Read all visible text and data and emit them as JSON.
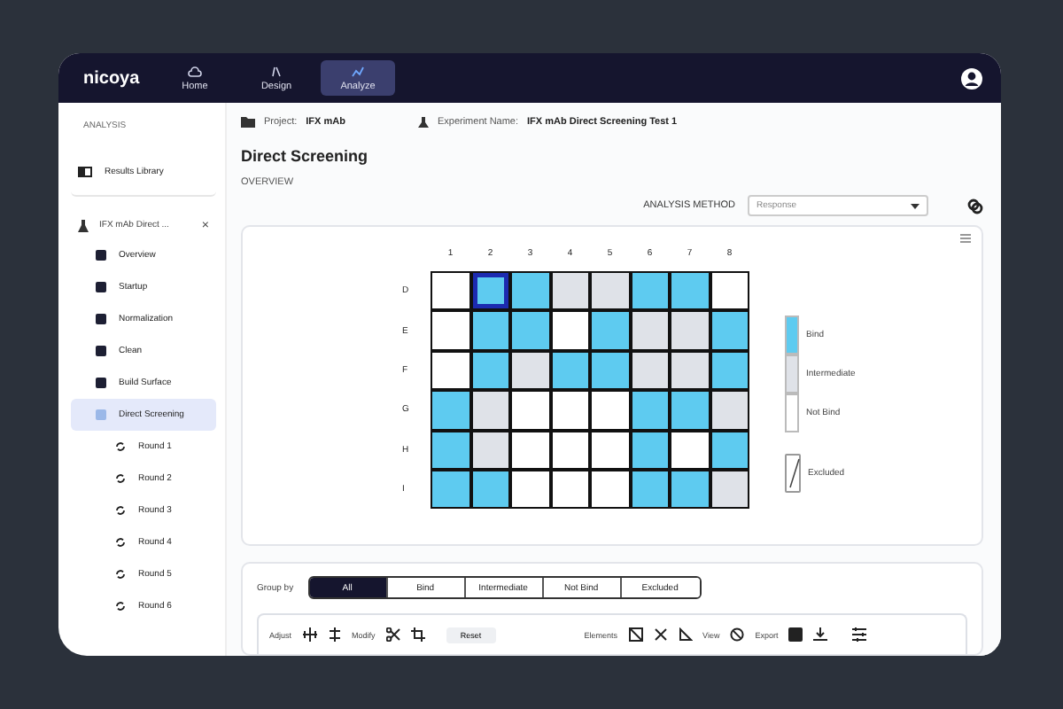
{
  "topbar": {
    "logo": "nicoya",
    "nav": [
      {
        "label": "Home",
        "selected": false
      },
      {
        "label": "Design",
        "selected": false
      },
      {
        "label": "Analyze",
        "selected": true
      }
    ]
  },
  "sidebar": {
    "heading": "ANALYSIS",
    "library": "Results Library",
    "experiment": "IFX mAb Direct ...",
    "close": "×",
    "items": [
      {
        "label": "Overview",
        "kind": "step",
        "selected": false
      },
      {
        "label": "Startup",
        "kind": "step",
        "selected": false
      },
      {
        "label": "Normalization",
        "kind": "step",
        "selected": false
      },
      {
        "label": "Clean",
        "kind": "step",
        "selected": false
      },
      {
        "label": "Build Surface",
        "kind": "step",
        "selected": false
      },
      {
        "label": "Direct Screening",
        "kind": "step",
        "selected": true
      },
      {
        "label": "Round 1",
        "kind": "round",
        "selected": false
      },
      {
        "label": "Round 2",
        "kind": "round",
        "selected": false
      },
      {
        "label": "Round 3",
        "kind": "round",
        "selected": false
      },
      {
        "label": "Round 4",
        "kind": "round",
        "selected": false
      },
      {
        "label": "Round 5",
        "kind": "round",
        "selected": false
      },
      {
        "label": "Round 6",
        "kind": "round",
        "selected": false
      }
    ]
  },
  "header": {
    "project_label": "Project:",
    "project": "IFX mAb",
    "experiment_label": "Experiment Name:",
    "experiment": "IFX mAb Direct Screening Test 1",
    "title": "Direct Screening",
    "section": "OVERVIEW",
    "method_label": "ANALYSIS METHOD",
    "method_value": "Response"
  },
  "plate": {
    "columns": [
      "1",
      "2",
      "3",
      "4",
      "5",
      "6",
      "7",
      "8"
    ],
    "rows": [
      {
        "label": "D",
        "cells": [
          {
            "kind": "not_bind",
            "selected": false
          },
          {
            "kind": "bind",
            "selected": true
          },
          {
            "kind": "bind",
            "selected": false
          },
          {
            "kind": "intermediate",
            "selected": false
          },
          {
            "kind": "intermediate",
            "selected": false
          },
          {
            "kind": "bind",
            "selected": false
          },
          {
            "kind": "bind",
            "selected": false
          },
          {
            "kind": "not_bind",
            "selected": false
          }
        ]
      },
      {
        "label": "E",
        "cells": [
          {
            "kind": "not_bind",
            "selected": false
          },
          {
            "kind": "bind",
            "selected": false
          },
          {
            "kind": "bind",
            "selected": false
          },
          {
            "kind": "not_bind",
            "selected": false
          },
          {
            "kind": "bind",
            "selected": false
          },
          {
            "kind": "intermediate",
            "selected": false
          },
          {
            "kind": "intermediate",
            "selected": false
          },
          {
            "kind": "bind",
            "selected": false
          }
        ]
      },
      {
        "label": "F",
        "cells": [
          {
            "kind": "not_bind",
            "selected": false
          },
          {
            "kind": "bind",
            "selected": false
          },
          {
            "kind": "intermediate",
            "selected": false
          },
          {
            "kind": "bind",
            "selected": false
          },
          {
            "kind": "bind",
            "selected": false
          },
          {
            "kind": "intermediate",
            "selected": false
          },
          {
            "kind": "intermediate",
            "selected": false
          },
          {
            "kind": "bind",
            "selected": false
          }
        ]
      },
      {
        "label": "G",
        "cells": [
          {
            "kind": "bind",
            "selected": false
          },
          {
            "kind": "intermediate",
            "selected": false
          },
          {
            "kind": "not_bind",
            "selected": false
          },
          {
            "kind": "not_bind",
            "selected": false
          },
          {
            "kind": "not_bind",
            "selected": false
          },
          {
            "kind": "bind",
            "selected": false
          },
          {
            "kind": "bind",
            "selected": false
          },
          {
            "kind": "intermediate",
            "selected": false
          }
        ]
      },
      {
        "label": "H",
        "cells": [
          {
            "kind": "bind",
            "selected": false
          },
          {
            "kind": "intermediate",
            "selected": false
          },
          {
            "kind": "not_bind",
            "selected": false
          },
          {
            "kind": "not_bind",
            "selected": false
          },
          {
            "kind": "not_bind",
            "selected": false
          },
          {
            "kind": "bind",
            "selected": false
          },
          {
            "kind": "not_bind",
            "selected": false
          },
          {
            "kind": "bind",
            "selected": false
          }
        ]
      },
      {
        "label": "I",
        "cells": [
          {
            "kind": "bind",
            "selected": false
          },
          {
            "kind": "bind",
            "selected": false
          },
          {
            "kind": "not_bind",
            "selected": false
          },
          {
            "kind": "not_bind",
            "selected": false
          },
          {
            "kind": "not_bind",
            "selected": false
          },
          {
            "kind": "bind",
            "selected": false
          },
          {
            "kind": "bind",
            "selected": false
          },
          {
            "kind": "intermediate",
            "selected": false
          }
        ]
      }
    ],
    "legend": [
      {
        "label": "Bind",
        "kind": "bind"
      },
      {
        "label": "Intermediate",
        "kind": "intermediate"
      },
      {
        "label": "Not Bind",
        "kind": "not_bind"
      },
      {
        "label": "Excluded",
        "kind": "excluded"
      }
    ]
  },
  "group_by": {
    "label": "Group by",
    "options": [
      {
        "label": "All",
        "selected": true
      },
      {
        "label": "Bind",
        "selected": false
      },
      {
        "label": "Intermediate",
        "selected": false
      },
      {
        "label": "Not Bind",
        "selected": false
      },
      {
        "label": "Excluded",
        "selected": false
      }
    ]
  },
  "toolbar": {
    "adjust": "Adjust",
    "modify": "Modify",
    "reset": "Reset",
    "elements": "Elements",
    "view": "View",
    "export": "Export"
  }
}
